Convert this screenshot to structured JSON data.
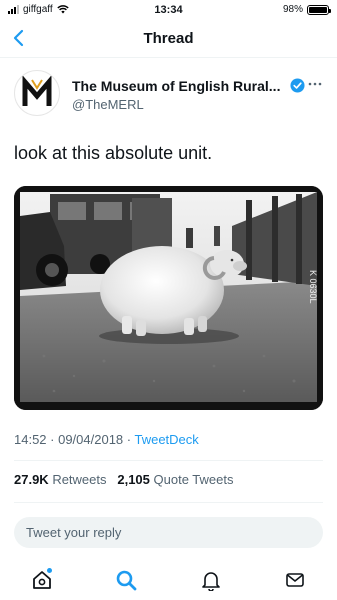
{
  "status_bar": {
    "carrier": "giffgaff",
    "time": "13:34",
    "battery": "98%",
    "battery_level": 0.98
  },
  "nav": {
    "title": "Thread",
    "back_icon": "chevron-left-icon"
  },
  "author": {
    "name": "The Museum of English Rural...",
    "handle": "@TheMERL",
    "verified": true,
    "avatar_letter": "M"
  },
  "tweet": {
    "text": "look at this absolute unit.",
    "media_caption": "K 0630L",
    "timestamp": "14:52 · 09/04/2018",
    "separator": " · ",
    "source": "TweetDeck"
  },
  "stats": {
    "retweets_count": "27.9K",
    "retweets_label": " Retweets",
    "quotes_count": "2,105",
    "quotes_label": " Quote Tweets"
  },
  "reply": {
    "placeholder": "Tweet your reply"
  },
  "tabbar": {
    "items": [
      {
        "name": "home",
        "icon": "home-icon",
        "notification_dot": true
      },
      {
        "name": "search",
        "icon": "search-icon",
        "active": true
      },
      {
        "name": "notifications",
        "icon": "bell-icon"
      },
      {
        "name": "messages",
        "icon": "mail-icon"
      }
    ]
  },
  "colors": {
    "accent": "#1d9bf0",
    "text": "#0f1419",
    "secondary": "#536471",
    "divider": "#eff3f4"
  }
}
